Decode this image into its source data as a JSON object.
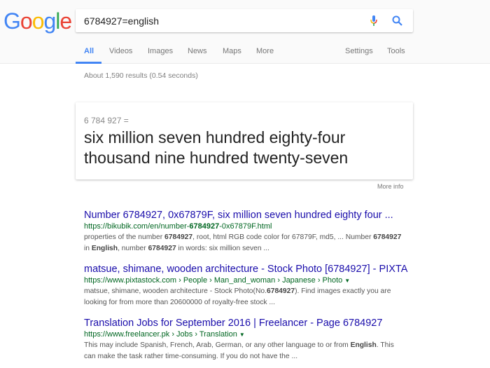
{
  "logo": {
    "letters": [
      "G",
      "o",
      "o",
      "g",
      "l",
      "e"
    ],
    "colors": [
      "#4285f4",
      "#ea4335",
      "#fbbc05",
      "#4285f4",
      "#34a853",
      "#ea4335"
    ]
  },
  "search": {
    "query": "6784927=english"
  },
  "tabs": [
    "All",
    "Videos",
    "Images",
    "News",
    "Maps",
    "More"
  ],
  "tools": [
    "Settings",
    "Tools"
  ],
  "stats": "About 1,590 results (0.54 seconds)",
  "answer": {
    "expression": "6 784 927 =",
    "line1": "six million seven hundred eighty-four",
    "line2": "thousand nine hundred twenty-seven",
    "more_info": "More info"
  },
  "results": [
    {
      "title": "Number 6784927, 0x67879F, six million seven hundred eighty four ...",
      "url": [
        "https://bikubik.com/en/number-",
        "6784927",
        "-0x67879F.html"
      ],
      "snippet": [
        "properties of the number ",
        "6784927",
        ", root, html RGB code color for 67879F, md5, ... Number ",
        "6784927",
        " in ",
        "English",
        ", number ",
        "6784927",
        " in words: six million seven ..."
      ]
    },
    {
      "title": "matsue, shimane, wooden architecture - Stock Photo [6784927] - PIXTA",
      "url": "https://www.pixtastock.com › People › Man_and_woman › Japanese › Photo",
      "snippet": [
        "matsue, shimane, wooden architecture - Stock Photo(No.",
        "6784927",
        "). Find images exactly you are looking for from more than 20600000 of royalty-free stock ..."
      ]
    },
    {
      "title": "Translation Jobs for September 2016 | Freelancer - Page 6784927",
      "url": "https://www.freelancer.pk › Jobs › Translation",
      "snippet": [
        "This may include Spanish, French, Arab, German, or any other language to or from ",
        "English",
        ". This can make the task rather time-consuming. If you do not have the ..."
      ]
    }
  ],
  "caret": "▼",
  "accent": "#4285f4"
}
